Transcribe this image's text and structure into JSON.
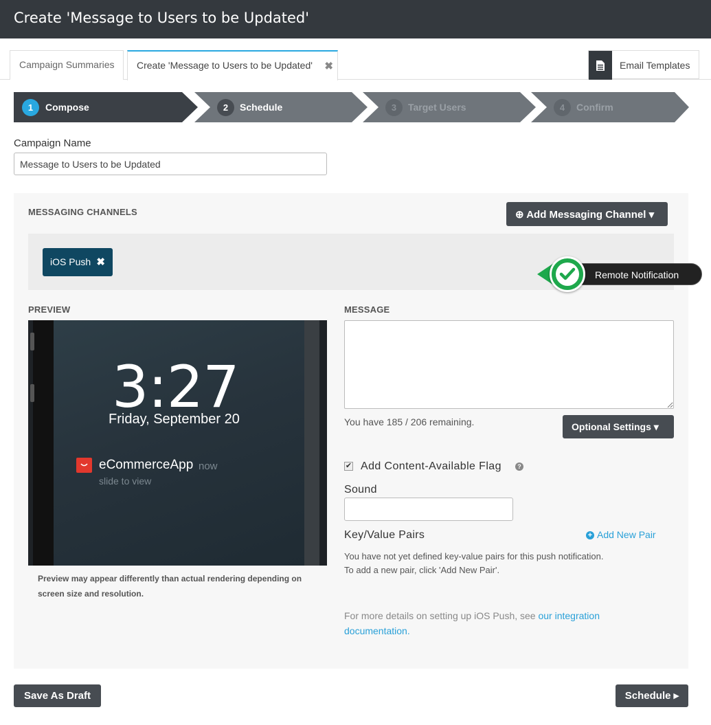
{
  "window": {
    "title": "Create 'Message to Users to be Updated'"
  },
  "tabs": [
    {
      "label": "Campaign Summaries"
    },
    {
      "label": "Create 'Message to Users to be Updated'",
      "close": "✖"
    }
  ],
  "email_templates": {
    "label": "Email Templates",
    "icon": "document-icon"
  },
  "wizard": {
    "steps": [
      {
        "num": "1",
        "label": "Compose",
        "state": "active"
      },
      {
        "num": "2",
        "label": "Schedule",
        "state": "enabled"
      },
      {
        "num": "3",
        "label": "Target Users",
        "state": "disabled"
      },
      {
        "num": "4",
        "label": "Confirm",
        "state": "disabled"
      }
    ]
  },
  "campaign": {
    "label": "Campaign Name",
    "value": "Message to Users to be Updated"
  },
  "channels": {
    "heading": "MESSAGING CHANNELS",
    "add_button": "Add Messaging Channel",
    "chips": [
      {
        "label": "iOS Push",
        "remove": "✖"
      }
    ]
  },
  "preview": {
    "heading": "PREVIEW",
    "time": "3:27",
    "date": "Friday, September 20",
    "app_name": "eCommerceApp",
    "when": "now",
    "slide": "slide to view",
    "note": "Preview may appear differently than actual rendering depending on screen size and resolution."
  },
  "message": {
    "heading": "MESSAGE",
    "value": "",
    "remaining": "You have 185 / 206 remaining.",
    "optional_settings": "Optional Settings"
  },
  "content_flag": {
    "label": "Add Content-Available Flag",
    "checked": true,
    "help": "?"
  },
  "callout": {
    "label": "Remote Notification",
    "color": "#1ea84c"
  },
  "sound": {
    "label": "Sound",
    "value": ""
  },
  "kv": {
    "label": "Key/Value Pairs",
    "add": "Add New Pair",
    "note1": "You have not yet defined key-value pairs for this push notification.",
    "note2": "To add a new pair, click 'Add New Pair'."
  },
  "more_details": {
    "prefix": "For more details on setting up iOS Push, see ",
    "link": "our integration documentation."
  },
  "footer": {
    "save_draft": "Save As Draft",
    "schedule": "Schedule"
  },
  "colors": {
    "accent": "#29a8e0",
    "dark": "#34393e",
    "chip": "#0f4761",
    "button": "#474c52"
  }
}
